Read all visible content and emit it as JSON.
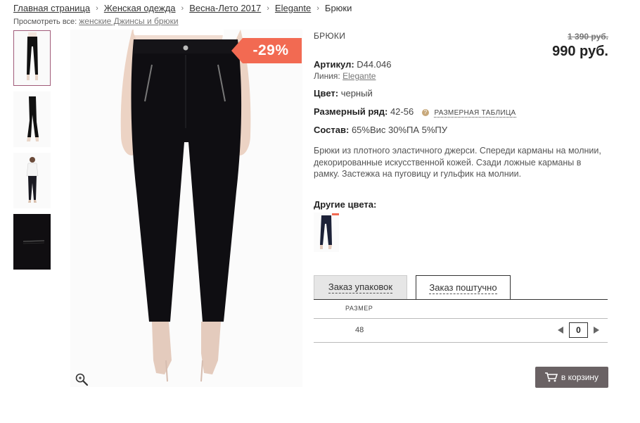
{
  "breadcrumb": {
    "items": [
      "Главная страница",
      "Женская одежда",
      "Весна-Лето 2017",
      "Elegante"
    ],
    "current": "Брюки",
    "separator": "›"
  },
  "view_all": {
    "label": "Просмотреть все:",
    "link": "женские Джинсы и брюки"
  },
  "product": {
    "category": "БРЮКИ",
    "old_price": "1 390 руб.",
    "price": "990 руб.",
    "discount": "-29%",
    "article_label": "Артикул:",
    "article_value": "D44.046",
    "line_label": "Линия:",
    "line_value": "Elegante",
    "color_label": "Цвет:",
    "color_value": "черный",
    "size_range_label": "Размерный ряд:",
    "size_range_value": "42-56",
    "size_help": "?",
    "size_table_link": "РАЗМЕРНАЯ ТАБЛИЦА",
    "composition_label": "Состав:",
    "composition_value": "65%Вис 30%ПА 5%ПУ",
    "description": "Брюки из плотного эластичного джерси. Спереди карманы на молнии, декорированные искусственной кожей. Сзади ложные карманы в рамку. Застежка на пуговицу и гульфик на молнии.",
    "other_colors_label": "Другие цвета:"
  },
  "order": {
    "tabs": [
      "Заказ упаковок",
      "Заказ поштучно"
    ],
    "active_tab": 1,
    "size_header": "РАЗМЕР",
    "rows": [
      {
        "size": "48",
        "qty": "0"
      }
    ]
  },
  "cart_button": "в корзину",
  "colors": {
    "accent": "#f26a52",
    "button": "#6a6264",
    "active_thumb_border": "#a05b79"
  }
}
